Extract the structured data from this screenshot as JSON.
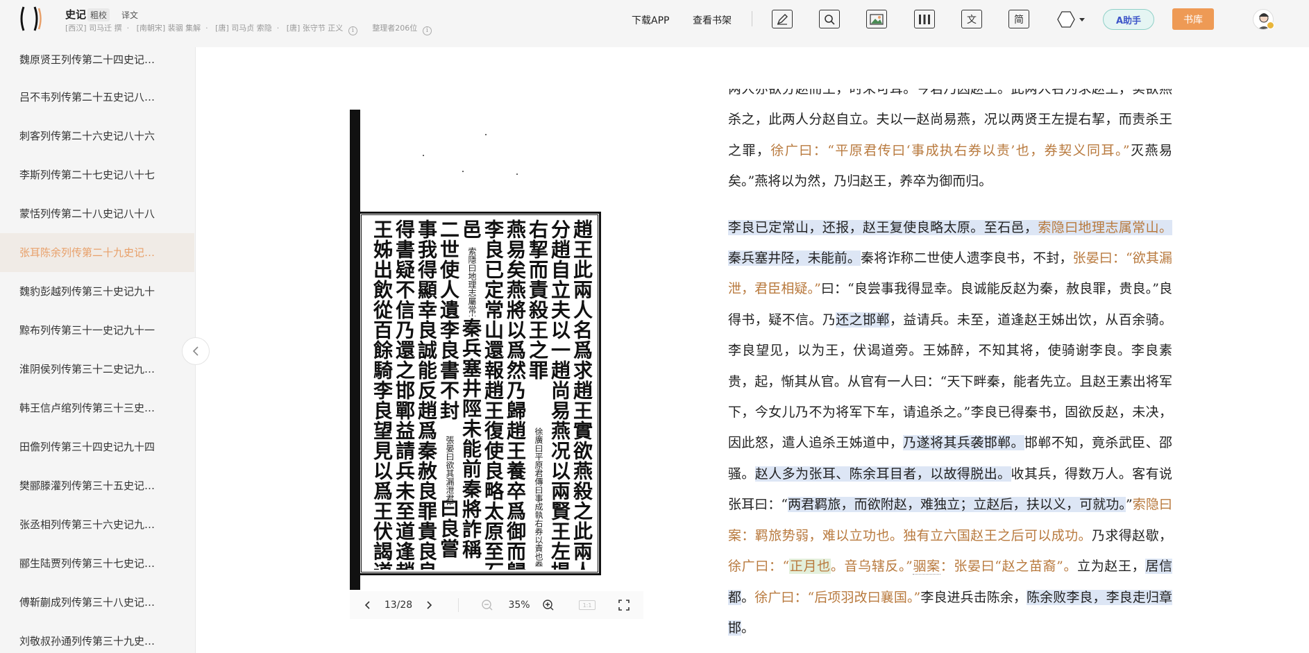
{
  "header": {
    "book_title": "史记",
    "modes": [
      "粗校",
      "译文"
    ],
    "authors": [
      "[西汉] 司马迁 撰",
      "[南朝宋] 裴骃 集解",
      "[唐] 司马贞 索隐",
      "[唐] 张守节 正义"
    ],
    "editors": "整理者206位",
    "nav": {
      "download": "下载APP",
      "bookshelf": "查看书架"
    },
    "tools": [
      {
        "name": "pen-icon"
      },
      {
        "name": "search-icon"
      },
      {
        "name": "image-icon"
      },
      {
        "name": "columns-icon"
      },
      {
        "name": "text-icon",
        "label": "文"
      },
      {
        "name": "simplified-icon",
        "label": "简"
      }
    ],
    "assistant_label": "A助手",
    "library_label": "书库"
  },
  "sidebar": {
    "items": [
      {
        "label": "魏原贤王列传第二十四史记…"
      },
      {
        "label": "吕不韦列传第二十五史记八…"
      },
      {
        "label": "刺客列传第二十六史记八十六"
      },
      {
        "label": "李斯列传第二十七史记八十七"
      },
      {
        "label": "蒙恬列传第二十八史记八十八"
      },
      {
        "label": "张耳陈余列传第二十九史记…",
        "active": true
      },
      {
        "label": "魏豹彭越列传第三十史记九十"
      },
      {
        "label": "黥布列传第三十一史记九十一"
      },
      {
        "label": "淮阴侯列传第三十二史记九…"
      },
      {
        "label": "韩王信卢绾列传第三十三史…"
      },
      {
        "label": "田儋列传第三十四史记九十四"
      },
      {
        "label": "樊郦滕灌列传第三十五史记…"
      },
      {
        "label": "张丞相列传第三十六史记九…"
      },
      {
        "label": "郦生陆贾列传第三十七史记…"
      },
      {
        "label": "傅靳蒯成列传第三十八史记…"
      },
      {
        "label": "刘敬叔孙通列传第三十九史…"
      }
    ]
  },
  "scan": {
    "columns": [
      "趙王此兩人名爲求趙王實欲燕殺之此兩人",
      "分趙自立夫以一趙尚易燕况以兩賢王左提",
      "右挈而責殺王之罪",
      "燕易矣燕將以爲然乃歸趙王養卒爲御而歸",
      "李良已定常山還報趙王復使良略太原至石",
      "邑",
      "二世使人遺李良書不封",
      "事我得顯幸良誠能反趙爲秦赦良罪貴良良",
      "得書疑不信乃還之邯鄲益請兵未至道逢趙",
      "王姊出飲從百餘騎李良望見以爲王伏謁道"
    ],
    "notes": [
      "徐廣曰平原君傳曰事成執右券以責也券契義同耳滅",
      "索隱曰地理志屬常山",
      "秦兵塞井陘未能前秦將詐稱",
      "張晏曰欲其漏泄君臣相疑",
      "曰良嘗"
    ]
  },
  "viewer": {
    "page": "13/28",
    "zoom": "35%",
    "ratio_label": "1:1"
  },
  "text": {
    "p1": {
      "a": "两人亦欲分赵而王，时未可耳。今君乃囚赵王。此两人名为求赵王，实欲燕杀之，此两人分赵自立。夫以一赵尚易燕，况以两贤王左提右挈，而责杀王之罪，",
      "note1": "徐广曰：“平原君传曰‘事成执右券以责’也，券契义同耳。”",
      "b": "灭燕易矣。”燕将以为然，乃归赵王，养卒为御而归。"
    },
    "p2": {
      "s1": "李良已定常山，还报，赵王复使良略太原。至石邑，",
      "s1note": "索隐曰地理志属常山。",
      "s2": "秦兵塞井陉，未能前。",
      "s3": "秦将诈称二世使人遗李良书，不封，",
      "s3note": "张晏曰：“欲其漏泄，君臣相疑。”",
      "s4": "曰：“良尝事我得显幸。良诚能反赵为秦，赦良罪，贵良。”良得书，疑不信。乃",
      "s5": "还之邯郸",
      "s6": "，益请兵。未至，道逢赵王姊出饮，从百余骑。李良望见，以为王，伏谒道旁。王姊醉，不知其将，使骑谢李良。李良素贵，起，惭其从官。从官有一人曰：“天下畔秦，能者先立。且赵王素出将军下，今女儿乃不为将军下车，请追杀之。”李良已得秦书，固欲反赵，未决，因此怒，遣人追杀王姊道中，",
      "s7": "乃遂将其兵袭邯郸。",
      "s8": "邯郸不知，竟杀武臣、邵骚。",
      "s9": "赵人多为张耳、陈余耳目者，以故得脱出。",
      "s10": "收其兵，得数万人。客有说张耳曰：“",
      "s11": "两君羁旅，而欲附赵，难独立；立赵后，扶以义，可就功。",
      "s12": "”",
      "s12note": "索隐曰案：羁旅势弱，难以立功也。独有立六国赵王之后可以成功。",
      "s13": "乃求得赵歇，",
      "s13note_a": "徐广曰：“",
      "s13note_hl": "正月也",
      "s13note_b": "。音乌辖反。”",
      "s13note_c": "骃案",
      "s13note_d": "：张晏曰“赵之苗裔”。",
      "s14": "立为赵王，",
      "s15": "居信都",
      "s16": "。",
      "s16note": "徐广曰：“后项羽改曰襄国。”",
      "s17": "李良进兵击陈余，",
      "s18": "陈余败李良，李良走归章邯",
      "s19": "。"
    }
  }
}
